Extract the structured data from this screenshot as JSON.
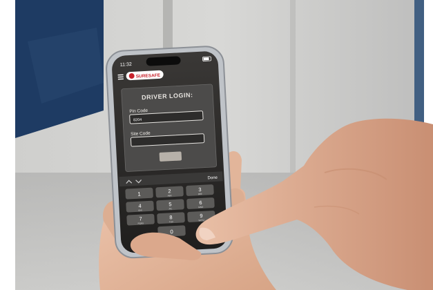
{
  "status_bar": {
    "time": "11:32",
    "icons_text": ""
  },
  "app": {
    "logo_text": "SURESAFE",
    "menu_icon": "hamburger-menu-icon"
  },
  "login": {
    "heading": "DRIVER LOGIN:",
    "pin_label": "Pin Code",
    "pin_value": "8204",
    "site_label": "Site Code",
    "site_value": ""
  },
  "keyboard": {
    "nav_icons": [
      "chevron-up-icon",
      "chevron-down-icon"
    ],
    "done_label": "Done",
    "keys": [
      {
        "num": "1",
        "letters": ""
      },
      {
        "num": "2",
        "letters": "ABC"
      },
      {
        "num": "3",
        "letters": "DEF"
      },
      {
        "num": "4",
        "letters": "GHI"
      },
      {
        "num": "5",
        "letters": "JKL"
      },
      {
        "num": "6",
        "letters": "MNO"
      },
      {
        "num": "7",
        "letters": "PQRS"
      },
      {
        "num": "8",
        "letters": "TUV"
      },
      {
        "num": "9",
        "letters": "WXYZ"
      },
      {
        "num": "0",
        "letters": ""
      }
    ]
  },
  "colors": {
    "wall": "#c9c9c7",
    "door_blue": "#1e3b63",
    "phone_frame": "#bfc3c8",
    "screen_dark": "#2b2a29",
    "login_panel": "#4c4b4a",
    "skin": "#e3b79e",
    "logo_red": "#c8232c"
  }
}
